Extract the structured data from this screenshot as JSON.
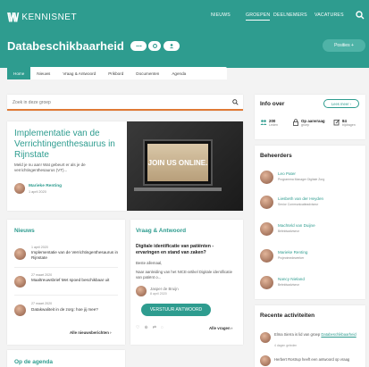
{
  "brand": {
    "name": "KENNISNET",
    "mark": "\\\\/\\\\/"
  },
  "topnav": [
    "NIEUWS",
    "GROEPEN",
    "DEELNEMERS",
    "VACATURES"
  ],
  "page_title": "Databeschikbaarheid",
  "posities_label": "Posities +",
  "tabs": [
    "Home",
    "Nieuws",
    "Vraag & Antwoord",
    "Prikbord",
    "Documenten",
    "Agenda"
  ],
  "search_placeholder": "Zoek in deze groep",
  "feature": {
    "title": "Implementatie van de Verrichtingenthesaurus in Rijnstate",
    "desc": "Meld je nu aan! Wat gebeurt er als je de verrichtingenthesaurus (VT)...",
    "author": "Marieke Renting",
    "date": "1 april 2020",
    "image_text": "JOIN US ONLINE."
  },
  "nieuws": {
    "title": "Nieuws",
    "items": [
      {
        "date": "1 april 2020",
        "text": "Implementatie van de Verrichtingenthesaurus in Rijnstate"
      },
      {
        "date": "27 maart 2020",
        "text": "Maaltreuwsbrief Met spoed beschikbaar uit"
      },
      {
        "date": "27 maart 2020",
        "text": "Datakwaliteit in de zorg: hoe jij mee?"
      }
    ],
    "more": "Alle nieuwsberichten"
  },
  "vraag": {
    "title": "Vraag & Antwoord",
    "question": "Digitale identificatie van patiënten - ervaringen en stand van zaken?",
    "greeting": "Beste allemaal,",
    "body": "Naar aanleiding van het NICE-artikel Digitale identificatie van patiënt o...",
    "author": "Jasper de Bruijn",
    "date": "8 april 2020",
    "button": "VERSTUUR ANTWOORD",
    "more": "Alle vragen",
    "icons": [
      "♡",
      "⊕",
      "⇄",
      "◌"
    ]
  },
  "agenda_title": "Op de agenda",
  "info": {
    "title": "Info over",
    "more": "Lees meer",
    "stats": [
      {
        "num": "200",
        "label": "Leden"
      },
      {
        "num": "Op aanvraag",
        "label": "groep"
      },
      {
        "num": "84",
        "label": "bijdragen"
      }
    ]
  },
  "beheerders": {
    "title": "Beheerders",
    "people": [
      {
        "name": "Leo Pater",
        "role": "Programma Manager Digitale Zorg"
      },
      {
        "name": "Liesbeth van der Heyden",
        "role": "Senior Communicatieadviseur"
      },
      {
        "name": "Machteld van Duijne",
        "role": "Beleidsadviseur"
      },
      {
        "name": "Marieke Renting",
        "role": "Projectmedewerker"
      },
      {
        "name": "Nancy Nieland",
        "role": "Beleidsadviseur"
      }
    ]
  },
  "recent": {
    "title": "Recente activiteiten",
    "items": [
      {
        "text_pre": "Elma Sierra is lid van groep",
        "link": "Databeschikbaarheid",
        "date": "4 dagen geleden"
      },
      {
        "text_pre": "Herbert Rostrup heeft een antwoord op vraag",
        "link": "",
        "date": ""
      }
    ]
  },
  "colors": {
    "accent": "#2e9c8f",
    "orange": "#e07a35"
  }
}
